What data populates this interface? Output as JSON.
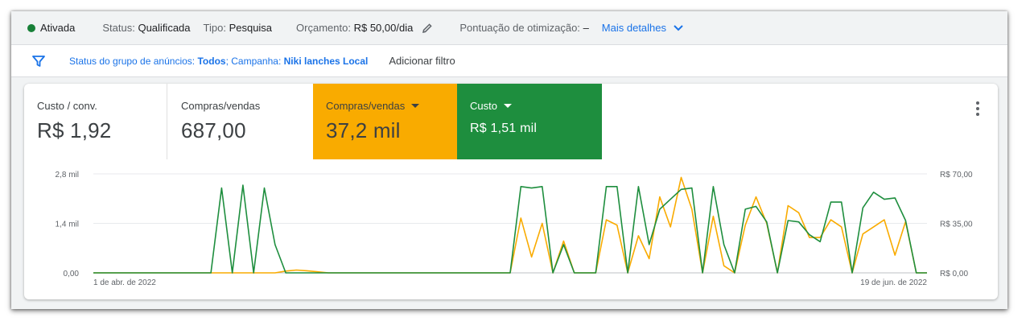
{
  "status": {
    "state": "Ativada",
    "status_label": "Status:",
    "status_value": "Qualificada",
    "type_label": "Tipo:",
    "type_value": "Pesquisa",
    "budget_label": "Orçamento:",
    "budget_value": "R$ 50,00/dia",
    "score_label": "Pontuação de otimização:",
    "score_value": "–",
    "details_link": "Mais detalhes"
  },
  "filters": {
    "prefix": "Status do grupo de anúncios:",
    "status_value": "Todos",
    "campaign_prefix": "; Campanha:",
    "campaign_value": "Niki lanches Local",
    "add_filter": "Adicionar filtro"
  },
  "metrics": [
    {
      "label": "Custo / conv.",
      "value": "R$ 1,92"
    },
    {
      "label": "Compras/vendas",
      "value": "687,00"
    },
    {
      "label": "Compras/vendas",
      "value": "37,2 mil"
    },
    {
      "label": "Custo",
      "value": "R$ 1,51 mil"
    }
  ],
  "colors": {
    "accent": "#1a73e8",
    "active_dot": "#188038",
    "series_orange": "#f9ab00",
    "series_green": "#1e8e3e"
  },
  "chart_data": {
    "type": "line",
    "x_start_label": "1 de abr. de 2022",
    "x_end_label": "19 de jun. de 2022",
    "left_ticks": [
      "0,00",
      "1,4 mil",
      "2,8 mil"
    ],
    "right_ticks": [
      "R$ 0,00",
      "R$ 35,00",
      "R$ 70,00"
    ],
    "ylim_left": [
      0,
      2800
    ],
    "ylim_right": [
      0,
      70
    ],
    "series": [
      {
        "name": "Compras/vendas",
        "axis": "left",
        "values": [
          0,
          0,
          0,
          0,
          0,
          0,
          0,
          0,
          0,
          0,
          0,
          0,
          0,
          0,
          0,
          0,
          0,
          0,
          0,
          0,
          0,
          0,
          0,
          0,
          0,
          0,
          0,
          0,
          0,
          0,
          0,
          0,
          0,
          0,
          0,
          0,
          0,
          0,
          0,
          0,
          1550,
          450,
          1400,
          0,
          900,
          0,
          0,
          0,
          1500,
          1350,
          0,
          1050,
          400,
          2150,
          1300,
          2700,
          1800,
          0,
          1600,
          200,
          0,
          1350,
          2150,
          1400,
          0,
          1900,
          1700,
          1000,
          1000,
          1500,
          1300,
          0,
          1100,
          1300,
          1500,
          500,
          1450,
          0,
          0
        ],
        "extra": {
          "18": 50,
          "19": 80,
          "20": 60,
          "21": 30
        }
      },
      {
        "name": "Custo",
        "axis": "right",
        "values": [
          0,
          0,
          0,
          0,
          0,
          0,
          0,
          0,
          0,
          0,
          0,
          0,
          60,
          0,
          62,
          0,
          60,
          20,
          0,
          0,
          0,
          0,
          0,
          0,
          0,
          0,
          0,
          0,
          0,
          0,
          0,
          0,
          0,
          0,
          0,
          0,
          0,
          0,
          0,
          0,
          61,
          60,
          61,
          0,
          20,
          0,
          0,
          0,
          61,
          61,
          0,
          61,
          20,
          45,
          52,
          59,
          60,
          0,
          61,
          20,
          0,
          45,
          47,
          36,
          0,
          37,
          36,
          27,
          22,
          50,
          50,
          0,
          46,
          57,
          52,
          53,
          37,
          0,
          0
        ]
      }
    ]
  }
}
